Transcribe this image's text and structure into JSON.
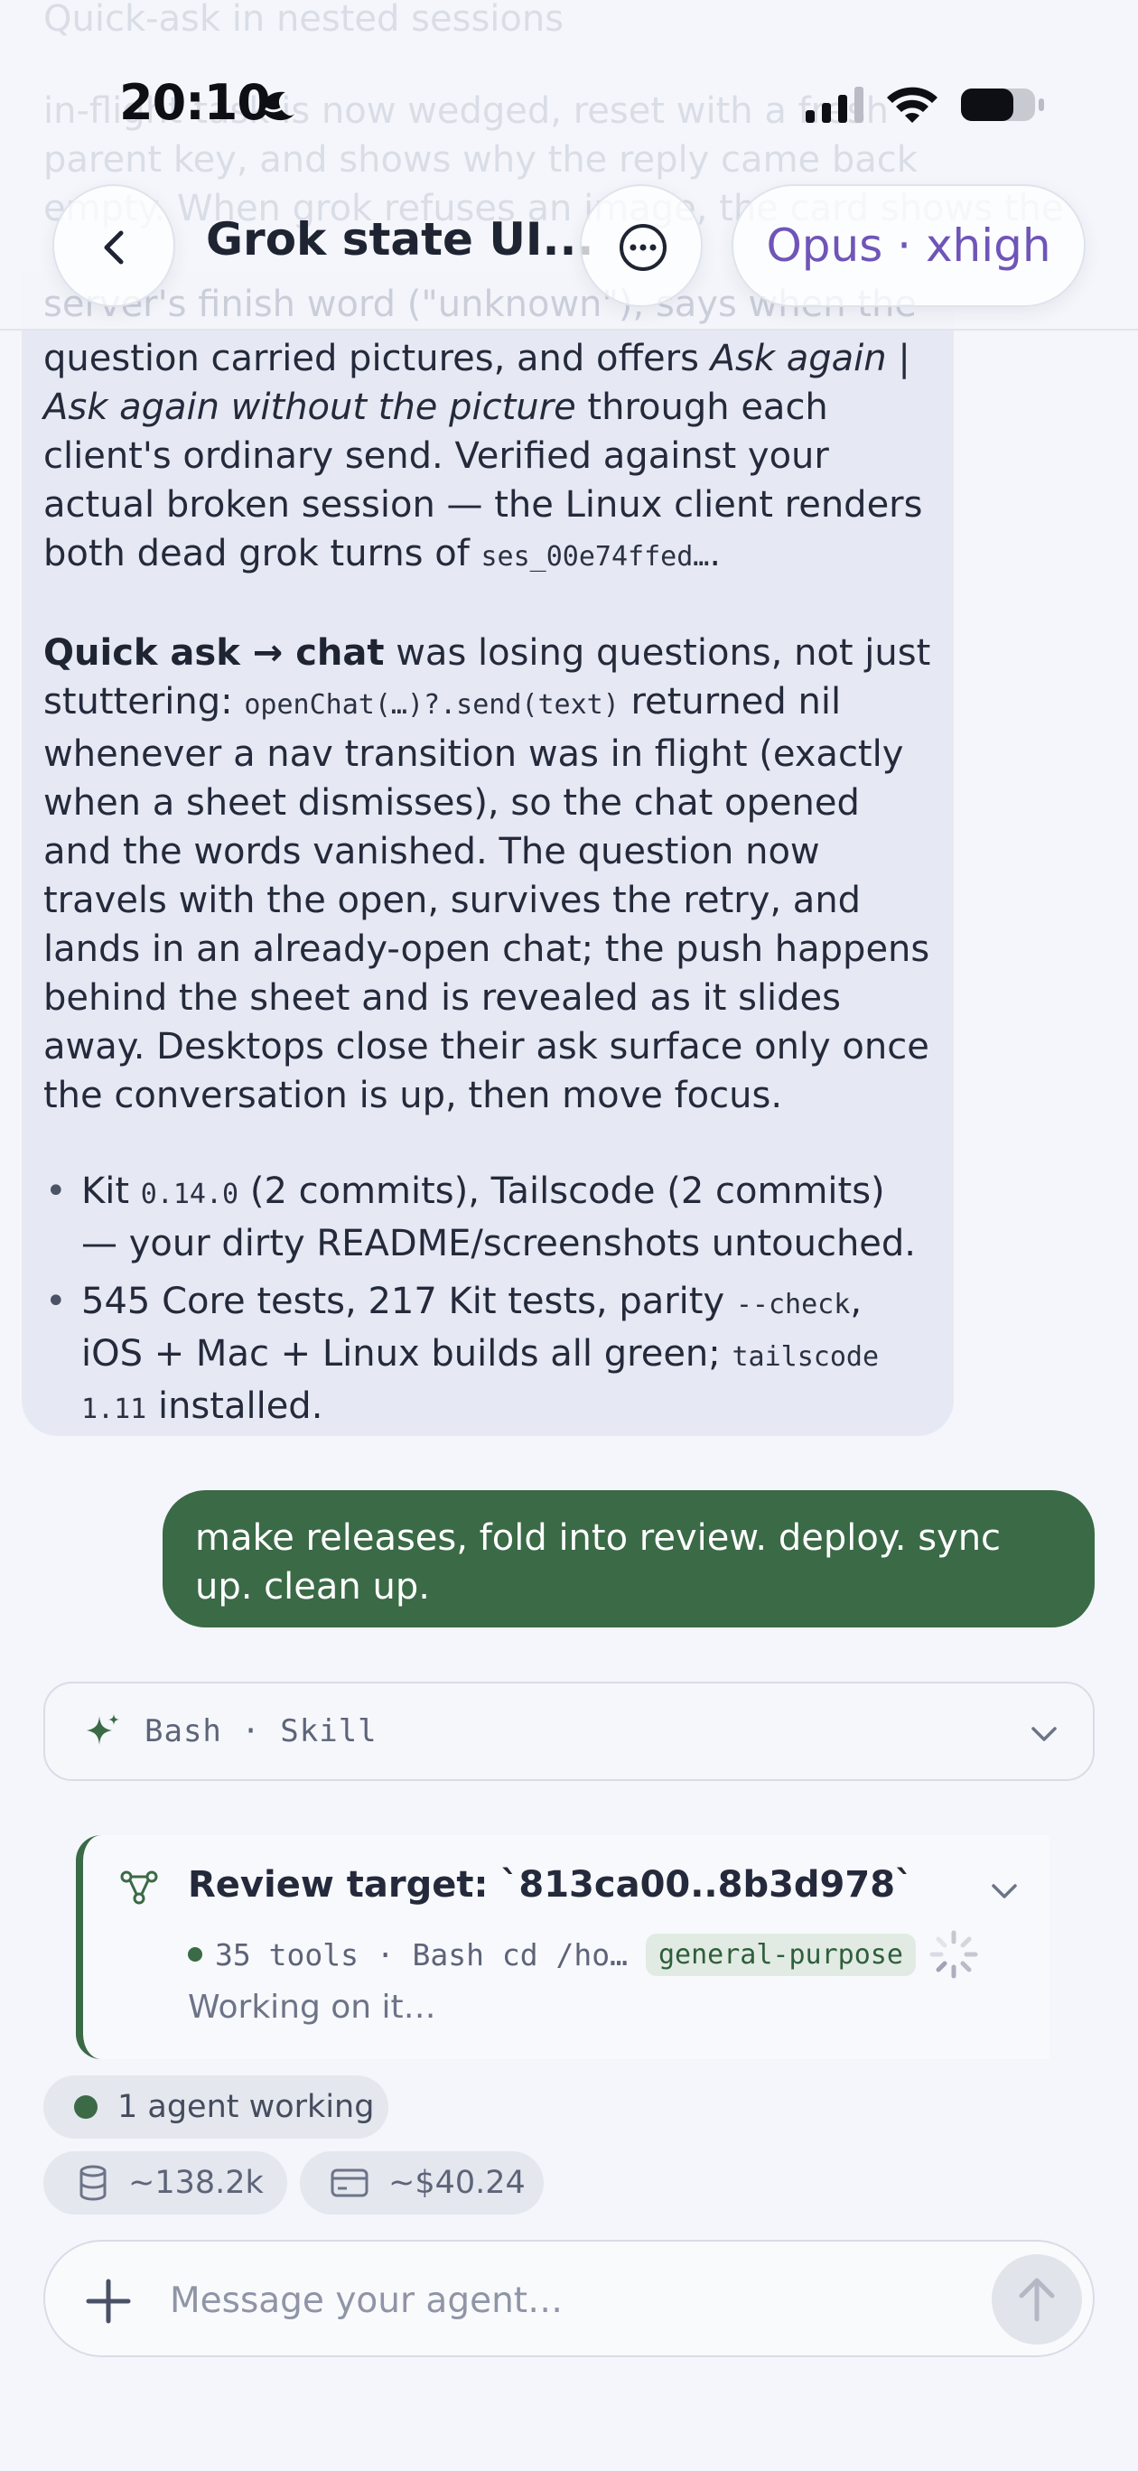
{
  "status_bar": {
    "time": "20:10"
  },
  "header": {
    "title": "Grok state UI...",
    "model": "Opus · xhigh",
    "ghost_lines": [
      "Quick-ask in nested sessions",
      "in-flight task is now wedged, reset with a fresh",
      "parent key, and shows why the reply came back",
      "empty. When grok refuses an image, the card shows the",
      "server's finish word (\"unknown\"), says when the"
    ]
  },
  "assistant_message": {
    "p1": {
      "t1": "question carried pictures, and offers ",
      "em1": "Ask again",
      "t2": " | ",
      "em2": "Ask again without the picture",
      "t3": " through each client's ordinary send. Verified against your actual broken session — the Linux client renders both dead grok turns of ",
      "code1": "ses_00e74ffed…",
      "t4": "."
    },
    "p2": {
      "strong": "Quick ask → chat",
      "t1": " was losing questions, not just stuttering: ",
      "code1": "openChat(…)?.send(text)",
      "t2": " returned nil whenever a nav transition was in flight (exactly when a sheet dismisses), so the chat opened and the words vanished. The question now travels with the open, survives the retry, and lands in an already-open chat; the push happens behind the sheet and is revealed as it slides away. Desktops close their ask surface only once the conversation is up, then move focus."
    },
    "bullets": [
      {
        "t1": "Kit ",
        "code1": "0.14.0",
        "t2": " (2 commits), Tailscode (2 commits) — your dirty README/screenshots untouched."
      },
      {
        "t1": "545 Core tests, 217 Kit tests, parity ",
        "code1": "--check",
        "t2": ", iOS + Mac + Linux builds all green; ",
        "code2": "tailscode 1.11",
        "t3": " installed."
      }
    ]
  },
  "user_message": {
    "text": "make releases, fold into review. deploy. sync up. clean up."
  },
  "tool_card": {
    "label": "Bash · Skill"
  },
  "agent_card": {
    "title": "Review target: `813ca00..8b3d978`",
    "tools": "35 tools · Bash cd /ho…",
    "type": "general-purpose",
    "status": "Working on it…"
  },
  "footer": {
    "agents_working": "1 agent working",
    "tokens": "~138.2k",
    "cost": "~$40.24"
  },
  "composer": {
    "placeholder": "Message your agent…"
  },
  "colors": {
    "accent_green": "#3a6a46",
    "model_purple": "#6f55b8",
    "assistant_bubble": "#e6e9f3",
    "background": "#f4f6fb"
  }
}
